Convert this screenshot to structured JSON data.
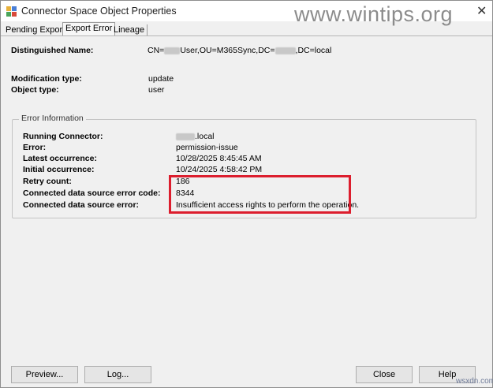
{
  "window": {
    "title": "Connector Space Object Properties",
    "close_glyph": "✕"
  },
  "watermark": "www.wintips.org",
  "tabs": [
    {
      "label": "Pending Export"
    },
    {
      "label": "Export Error"
    },
    {
      "label": "Lineage"
    }
  ],
  "fields": {
    "dn_label": "Distinguished Name:",
    "dn_value_prefix": "CN=",
    "dn_value_mid": "User,OU=M365Sync,DC=",
    "dn_value_suffix": ",DC=local",
    "mod_type_label": "Modification type:",
    "mod_type_value": "update",
    "obj_type_label": "Object type:",
    "obj_type_value": "user"
  },
  "error_info": {
    "group_title": "Error Information",
    "running_connector_label": "Running Connector:",
    "running_connector_suffix": ".local",
    "error_label": "Error:",
    "error_value": "permission-issue",
    "latest_label": "Latest occurrence:",
    "latest_value": "10/28/2025 8:45:45 AM",
    "initial_label": "Initial occurrence:",
    "initial_value": "10/24/2025 4:58:42 PM",
    "retry_label": "Retry count:",
    "retry_value": "186",
    "code_label": "Connected data source error code:",
    "code_value": "8344",
    "ds_error_label": "Connected data source error:",
    "ds_error_value": "Insufficient access rights to perform the operation."
  },
  "buttons": {
    "preview": "Preview...",
    "log": "Log...",
    "close": "Close",
    "help": "Help"
  },
  "footer_watermark": "wsxdn.com",
  "colors": {
    "highlight": "#dc1e2e",
    "background": "#f0f0f0"
  }
}
